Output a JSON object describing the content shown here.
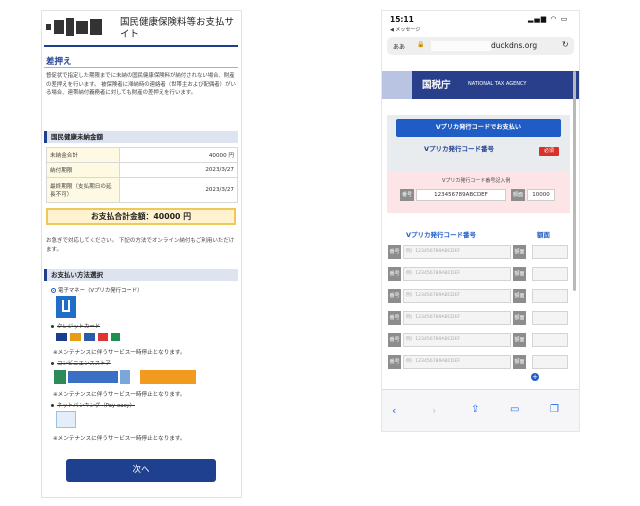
{
  "left": {
    "site_title": "国民健康保険料等お支払サイト",
    "section_title": "差押え",
    "paragraph": "督促状で指定した期限までに未納の国民健康保険料が納付されない場合、財産の差押えを行います。 被保険者に滞納時の連絡者（世帯主および配偶者）がいる場合、連帯納付義務者に対しても財産の差押えを行います。",
    "unpaid_header": "国民健康未納金額",
    "rows": [
      {
        "label": "未納金合計",
        "value": "40000 円"
      },
      {
        "label": "納付期限",
        "value": "2023/3/27"
      },
      {
        "label": "最終期限（支払期日の延長不可）",
        "value": "2023/3/27"
      }
    ],
    "total": "お支払合計金額：40000 円",
    "note": "お急ぎで対応してください。 下記の方法でオンライン納付もご利用いただけます。",
    "method_header": "お支払い方法選択",
    "options": [
      "電子マネー（Vプリカ発行コード）",
      "クレジットカード",
      "コンビニエンスストア",
      "ネットバンキング（Pay-easy）"
    ],
    "maintenance": "※メンテナンスに伴うサービス一時停止となります。",
    "next": "次へ"
  },
  "right": {
    "time": "15:11",
    "back_app": "◀ メッセージ",
    "url_prefix": "ああ",
    "url": "duckdns.org",
    "agency_jp": "国税庁",
    "agency_en": "NATIONAL TAX AGENCY",
    "pay_button": "Vプリカ発行コードでお支払い",
    "code_label": "Vプリカ発行コード番号",
    "required": "必須",
    "example_title": "Vプリカ発行コード番号記入例",
    "example_num_label": "番号",
    "example_code": "123456789ABCDEF",
    "example_amt_label": "額面",
    "example_amount": "10000",
    "col_code": "Vプリカ発行コード番号",
    "col_amount": "額面",
    "row_label": "番号",
    "row_placeholder": "例）123456789ABCDEF",
    "amount_label": "額面"
  },
  "colors": {
    "primary": "#1f3f8f",
    "accent": "#1f5cc6",
    "required": "#d9302c",
    "highlight": "#fff3cf"
  }
}
